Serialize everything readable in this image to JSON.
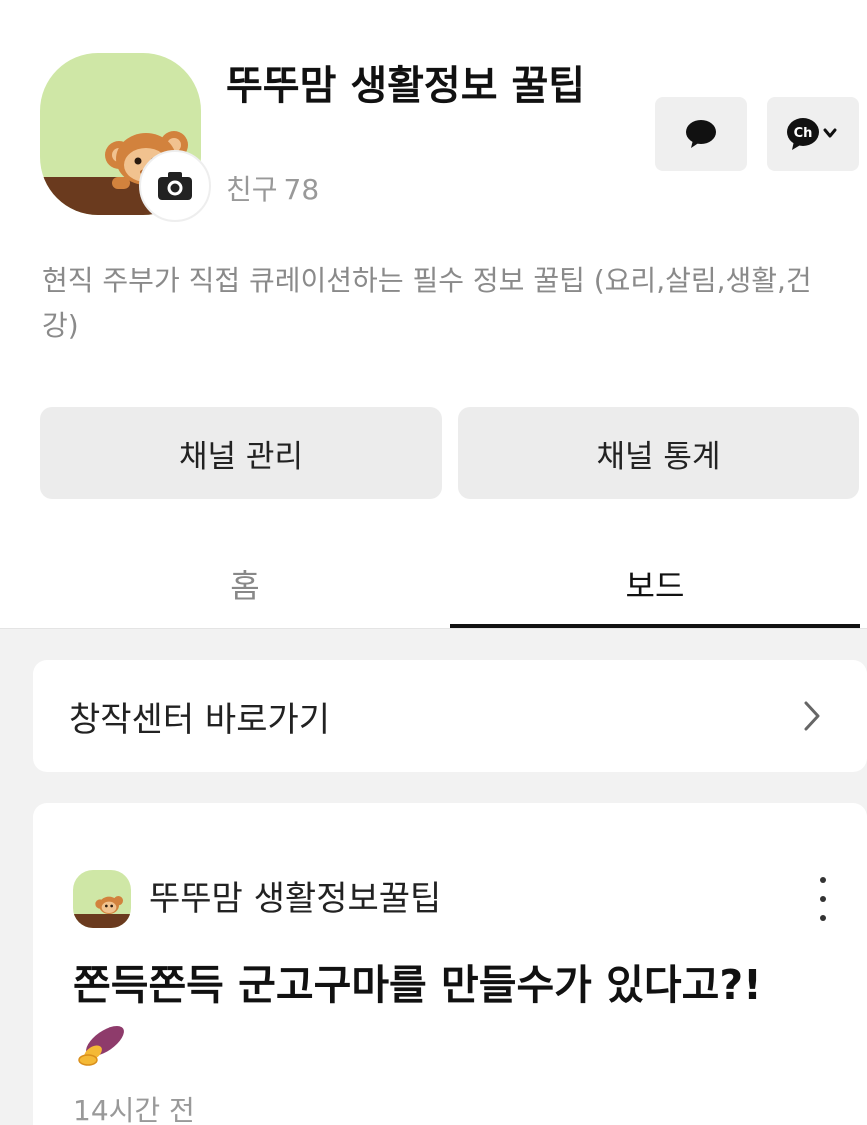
{
  "channel": {
    "title": "뚜뚜맘 생활정보 꿀팁",
    "friends_label": "친구",
    "friends_count": "78",
    "description": "현직 주부가 직접 큐레이션하는 필수 정보 꿀팁 (요리,살림,생활,건강)"
  },
  "icons": {
    "chat": "chat-bubble-icon",
    "channel": "ch-channel-icon",
    "camera": "camera-icon",
    "chevron": "chevron-right-icon",
    "more": "more-vertical-icon"
  },
  "actions": {
    "manage_label": "채널 관리",
    "stats_label": "채널 통계"
  },
  "tabs": {
    "home": "홈",
    "board": "보드",
    "active": "board"
  },
  "creator_center": {
    "label": "창작센터 바로가기"
  },
  "post": {
    "author": "뚜뚜맘 생활정보꿀팁",
    "title": "쫀득쫀득 군고구마를 만들수가 있다고?!",
    "time": "14시간 전"
  },
  "colors": {
    "profile_bg": "#cfe7a6",
    "ground": "#6a3a1e",
    "button_bg": "#ececec",
    "feed_bg": "#f2f2f2"
  }
}
